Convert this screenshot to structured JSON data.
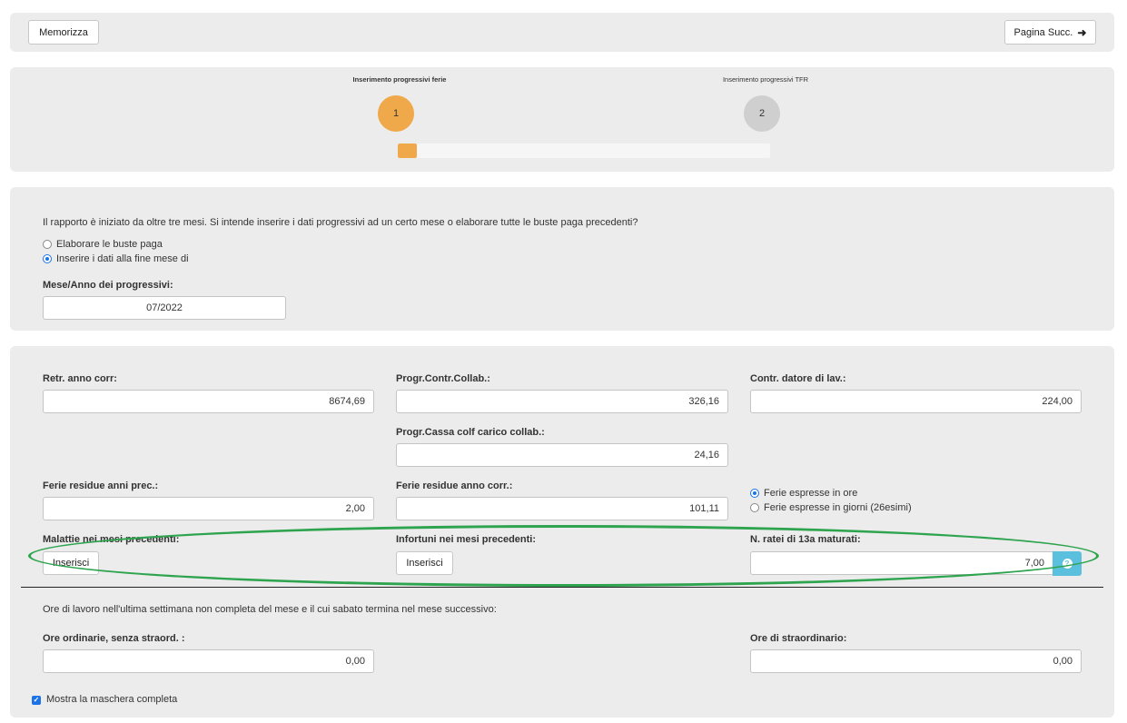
{
  "toolbar": {
    "save_label": "Memorizza",
    "next_label": "Pagina Succ.",
    "next_arrow": "➜"
  },
  "wizard": {
    "steps": [
      {
        "label": "Inserimento progressivi ferie",
        "number": "1",
        "active": true
      },
      {
        "label": "Inserimento progressivi TFR",
        "number": "2",
        "active": false
      }
    ],
    "progress_fraction": 0.05
  },
  "intro": {
    "question": "Il rapporto è iniziato da oltre tre mesi. Si intende inserire i dati progressivi ad un certo mese o elaborare tutte le buste paga precedenti?",
    "options": [
      {
        "label": "Elaborare le buste paga",
        "checked": false
      },
      {
        "label": "Inserire i dati alla fine mese di",
        "checked": true
      }
    ],
    "period_label": "Mese/Anno dei progressivi:",
    "period_value": "07/2022"
  },
  "form": {
    "retr_label": "Retr. anno corr:",
    "retr_value": "8674,69",
    "contr_collab_label": "Progr.Contr.Collab.:",
    "contr_collab_value": "326,16",
    "contr_datore_label": "Contr. datore di lav.:",
    "contr_datore_value": "224,00",
    "cassa_label": "Progr.Cassa colf carico collab.:",
    "cassa_value": "24,16",
    "ferie_prec_label": "Ferie residue anni prec.:",
    "ferie_prec_value": "2,00",
    "ferie_corr_label": "Ferie residue anno corr.:",
    "ferie_corr_value": "101,11",
    "ferie_options": [
      {
        "label": "Ferie espresse in ore",
        "checked": true
      },
      {
        "label": "Ferie espresse in giorni (26esimi)",
        "checked": false
      }
    ],
    "malattie_label": "Malattie nei mesi precedenti:",
    "malattie_button": "Inserisci",
    "infortuni_label": "Infortuni nei mesi precedenti:",
    "infortuni_button": "Inserisci",
    "ratei_label": "N. ratei di 13a maturati:",
    "ratei_value": "7,00",
    "help_symbol": "?",
    "ore_note": "Ore di lavoro nell'ultima settimana non completa del mese e il cui sabato termina nel mese successivo:",
    "ore_ord_label": "Ore ordinarie, senza straord. :",
    "ore_ord_value": "0,00",
    "ore_straord_label": "Ore di straordinario:",
    "ore_straord_value": "0,00",
    "show_full_label": "Mostra la maschera completa",
    "show_full_checked": true
  },
  "colors": {
    "active_step": "#efa94a",
    "inactive_step": "#cfcfcf",
    "accent": "#1a73e8",
    "help": "#5bc0de",
    "highlight": "#2ea44f",
    "panel": "#ececec"
  }
}
